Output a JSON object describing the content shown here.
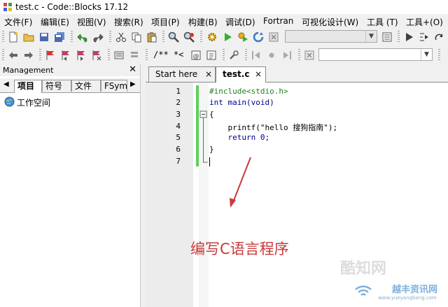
{
  "window": {
    "title": "test.c - Code::Blocks 17.12"
  },
  "menu": [
    "文件(F)",
    "编辑(E)",
    "视图(V)",
    "搜索(R)",
    "项目(P)",
    "构建(B)",
    "调试(D)",
    "Fortran",
    "可视化设计(W)",
    "工具 (T)",
    "工具+(O)"
  ],
  "toolbar2": {
    "comment_label": "/** *<"
  },
  "management": {
    "title": "Management",
    "tabs": [
      "项目",
      "符号",
      "文件",
      "FSym"
    ],
    "workspace": "工作空间"
  },
  "editor": {
    "tabs": [
      {
        "label": "Start here",
        "close": "×"
      },
      {
        "label": "test.c",
        "close": "×"
      }
    ],
    "lines": [
      {
        "n": "1",
        "code": "#include<stdio.h>"
      },
      {
        "n": "2",
        "code": "int main(void)"
      },
      {
        "n": "3",
        "code": "{"
      },
      {
        "n": "4",
        "code": "    printf(\"hello 搜狗指南\");"
      },
      {
        "n": "5",
        "code": "    return 0;"
      },
      {
        "n": "6",
        "code": "}"
      },
      {
        "n": "7",
        "code": ""
      }
    ]
  },
  "annotation": "编写C语言程序",
  "watermark": {
    "brand": "酷知网",
    "site": "越丰资讯网",
    "url": "www.yueyangbang.com"
  },
  "colors": {
    "annotation": "#c83a3a",
    "change_bar": "#5dd05d",
    "keyword": "#00008b",
    "preprocessor": "#208020",
    "number": "#e000e0"
  }
}
